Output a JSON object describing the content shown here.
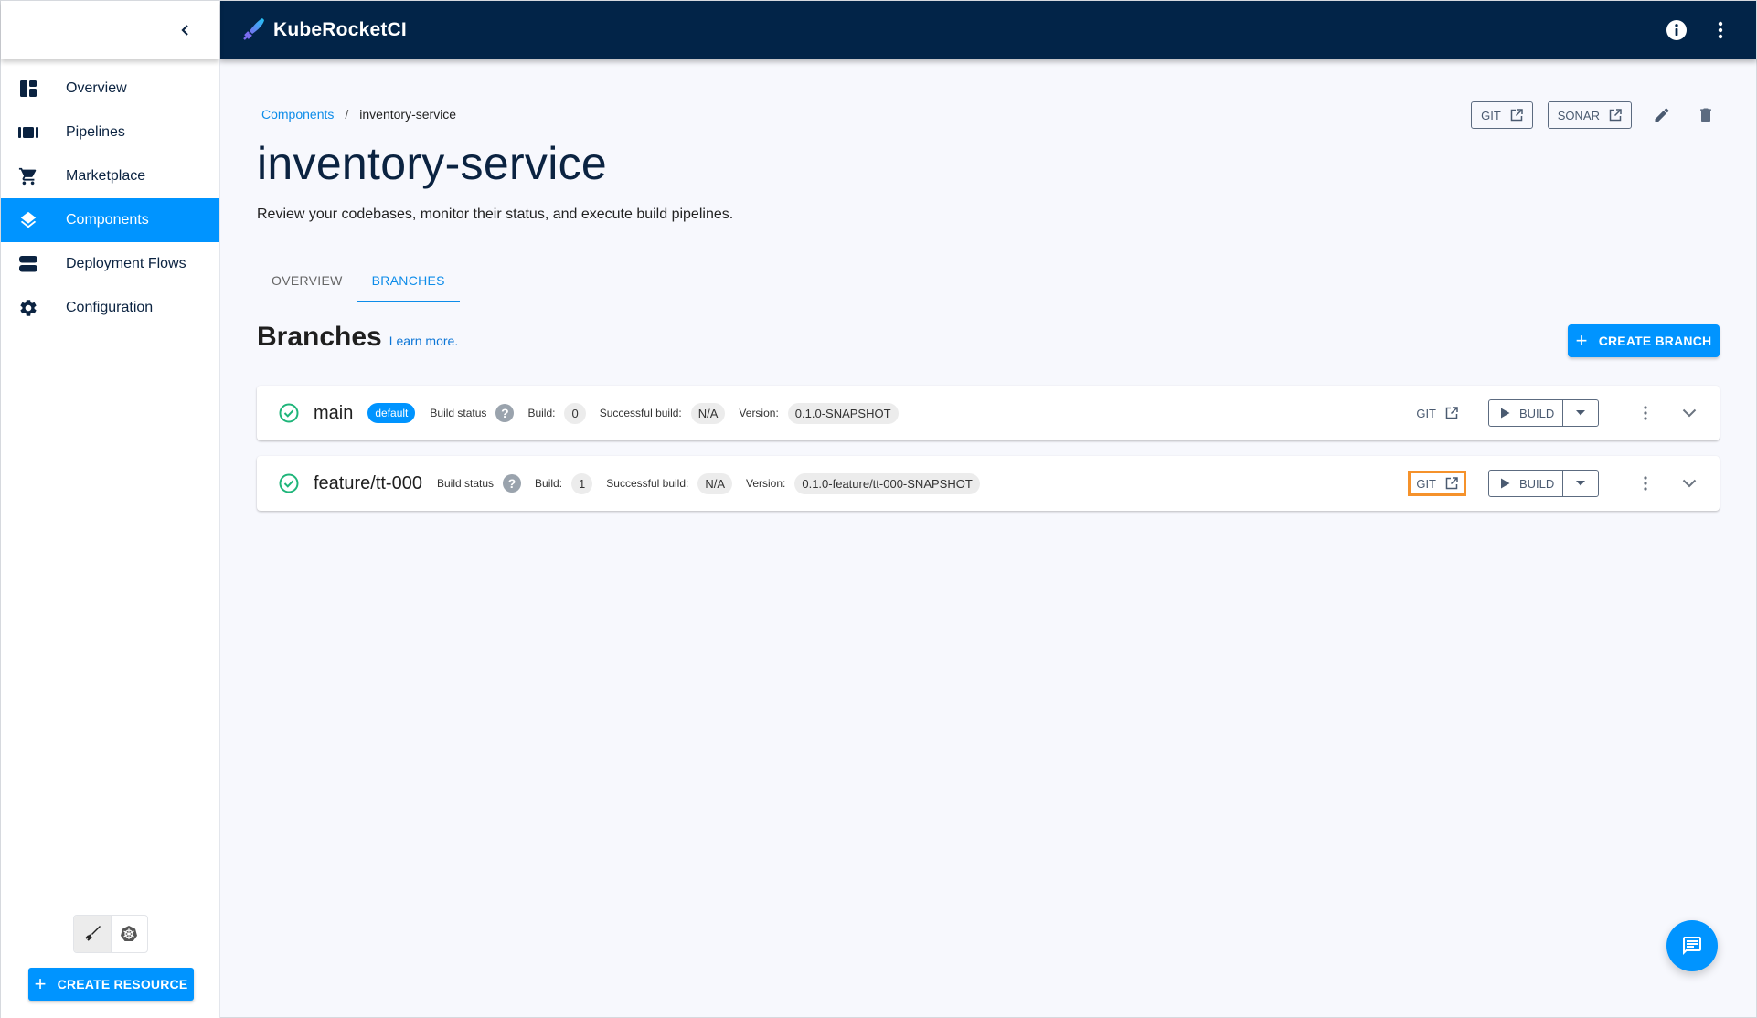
{
  "app": {
    "title": "KubeRocketCI",
    "colors": {
      "header_bg": "#022448",
      "accent": "#0094ff",
      "link": "#0d8ce9",
      "success": "#1fb57a",
      "highlight": "#f5922b"
    }
  },
  "sidebar": {
    "collapse_icon": "chevron-left-icon",
    "items": [
      {
        "label": "Overview",
        "icon": "dashboard-icon",
        "active": false
      },
      {
        "label": "Pipelines",
        "icon": "pipelines-icon",
        "active": false
      },
      {
        "label": "Marketplace",
        "icon": "cart-icon",
        "active": false
      },
      {
        "label": "Components",
        "icon": "layers-icon",
        "active": true
      },
      {
        "label": "Deployment Flows",
        "icon": "flows-icon",
        "active": false
      },
      {
        "label": "Configuration",
        "icon": "gear-icon",
        "active": false
      }
    ],
    "mode_toggle": [
      {
        "icon": "rocket-icon",
        "selected": true
      },
      {
        "icon": "kubernetes-icon",
        "selected": false
      }
    ],
    "create_resource_label": "CREATE RESOURCE"
  },
  "header": {
    "icons": [
      "info-icon",
      "more-vert-icon"
    ]
  },
  "breadcrumb": {
    "parent": "Components",
    "separator": "/",
    "current": "inventory-service"
  },
  "page": {
    "title": "inventory-service",
    "description": "Review your codebases, monitor their status, and execute build pipelines.",
    "actions": {
      "git_label": "GIT",
      "sonar_label": "SONAR"
    }
  },
  "tabs": [
    {
      "label": "OVERVIEW",
      "active": false
    },
    {
      "label": "BRANCHES",
      "active": true
    }
  ],
  "branches_section": {
    "title": "Branches",
    "learn_more": "Learn more.",
    "create_label": "CREATE BRANCH"
  },
  "branches": [
    {
      "name": "main",
      "badge": "default",
      "build_status_label": "Build status",
      "build_label": "Build:",
      "build": "0",
      "successful_build_label": "Successful build:",
      "successful_build": "N/A",
      "version_label": "Version:",
      "version": "0.1.0-SNAPSHOT",
      "git_label": "GIT",
      "build_button": "BUILD",
      "git_highlighted": false
    },
    {
      "name": "feature/tt-000",
      "badge": null,
      "build_status_label": "Build status",
      "build_label": "Build:",
      "build": "1",
      "successful_build_label": "Successful build:",
      "successful_build": "N/A",
      "version_label": "Version:",
      "version": "0.1.0-feature/tt-000-SNAPSHOT",
      "git_label": "GIT",
      "build_button": "BUILD",
      "git_highlighted": true
    }
  ],
  "help_glyph": "?",
  "plus_glyph": "+"
}
